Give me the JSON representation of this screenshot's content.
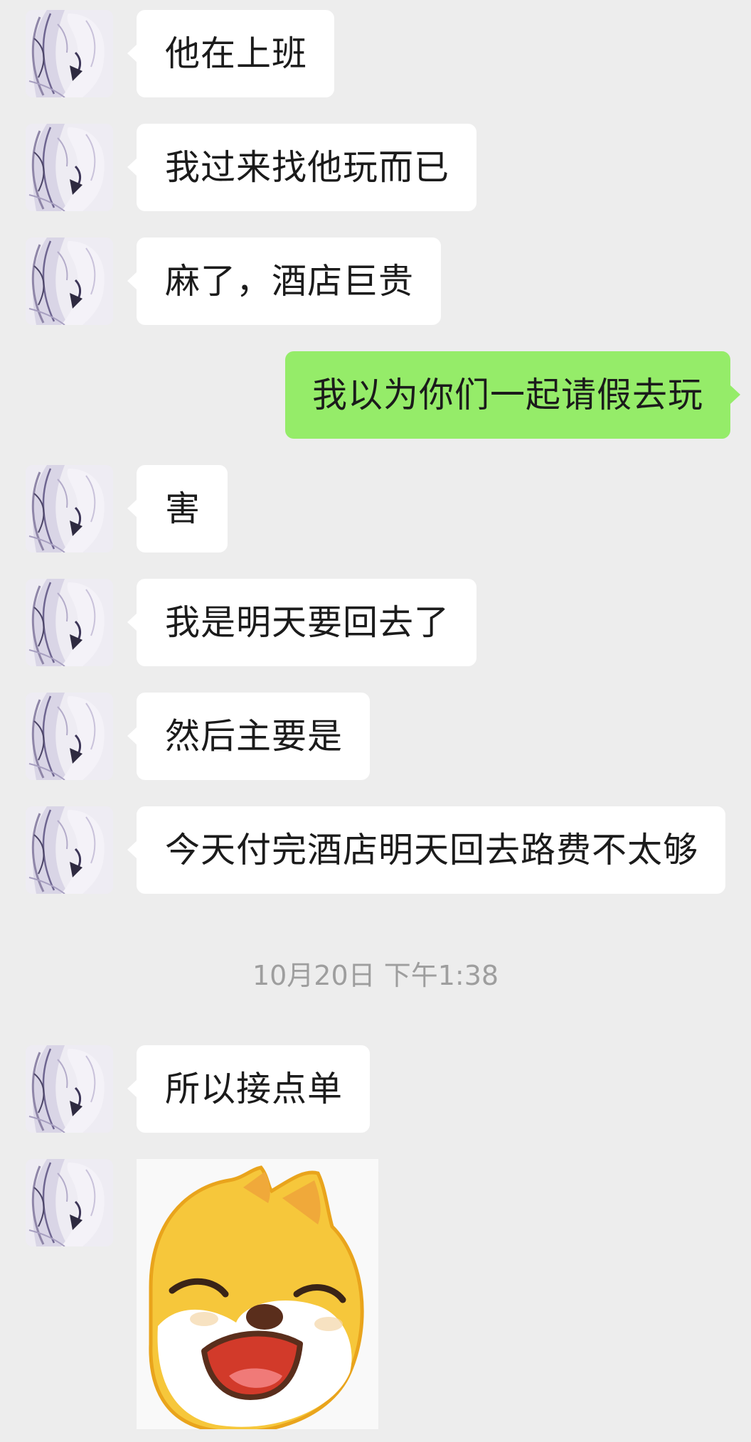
{
  "chat": {
    "messages": [
      {
        "side": "in",
        "text": "他在上班"
      },
      {
        "side": "in",
        "text": "我过来找他玩而已"
      },
      {
        "side": "in",
        "text": "麻了，酒店巨贵"
      },
      {
        "side": "out",
        "text": "我以为你们一起请假去玩"
      },
      {
        "side": "in",
        "text": "害"
      },
      {
        "side": "in",
        "text": "我是明天要回去了"
      },
      {
        "side": "in",
        "text": "然后主要是"
      },
      {
        "side": "in",
        "text": "今天付完酒店明天回去路费不太够"
      },
      {
        "side": "in",
        "text": "所以接点单"
      }
    ],
    "timestamp": "10月20日 下午1:38",
    "sticker": {
      "icon": "shiba-laughing-sticker-icon"
    },
    "avatar": {
      "icon": "anime-avatar-icon"
    }
  },
  "colors": {
    "background": "#ededed",
    "incoming_bubble": "#ffffff",
    "outgoing_bubble": "#95ec69",
    "timestamp_text": "#9e9e9e"
  }
}
